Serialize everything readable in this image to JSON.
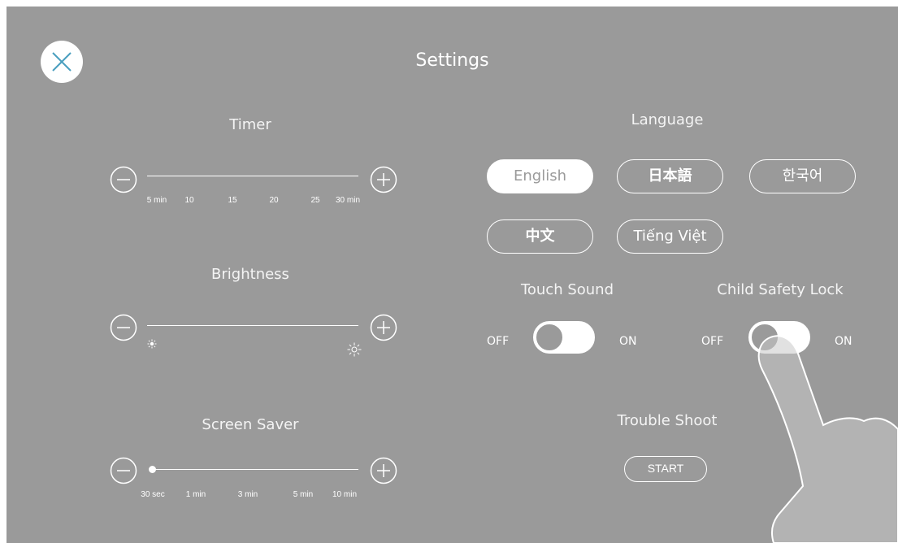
{
  "header": {
    "title": "Settings",
    "close_icon": "close-icon"
  },
  "timer": {
    "label": "Timer",
    "ticks": [
      "5 min",
      "10",
      "15",
      "20",
      "25",
      "30 min"
    ],
    "minus_icon": "minus-circle-icon",
    "plus_icon": "plus-circle-icon"
  },
  "brightness": {
    "label": "Brightness",
    "low_icon": "brightness-low-icon",
    "high_icon": "brightness-high-icon"
  },
  "screen_saver": {
    "label": "Screen Saver",
    "ticks": [
      "30 sec",
      "1 min",
      "3 min",
      "5 min",
      "10 min"
    ],
    "selected": "30 sec"
  },
  "language": {
    "label": "Language",
    "options": [
      "English",
      "日本語",
      "한국어",
      "中文",
      "Tiếng Việt"
    ],
    "selected": "English"
  },
  "touch_sound": {
    "label": "Touch Sound",
    "off": "OFF",
    "on": "ON",
    "state": "ON"
  },
  "child_lock": {
    "label": "Child Safety Lock",
    "off": "OFF",
    "on": "ON",
    "state": "ON"
  },
  "trouble_shoot": {
    "label": "Trouble Shoot",
    "button": "START"
  },
  "overlay": {
    "icon": "pointing-hand-icon"
  },
  "colors": {
    "background": "#9a9a9a",
    "foreground": "#ffffff"
  }
}
